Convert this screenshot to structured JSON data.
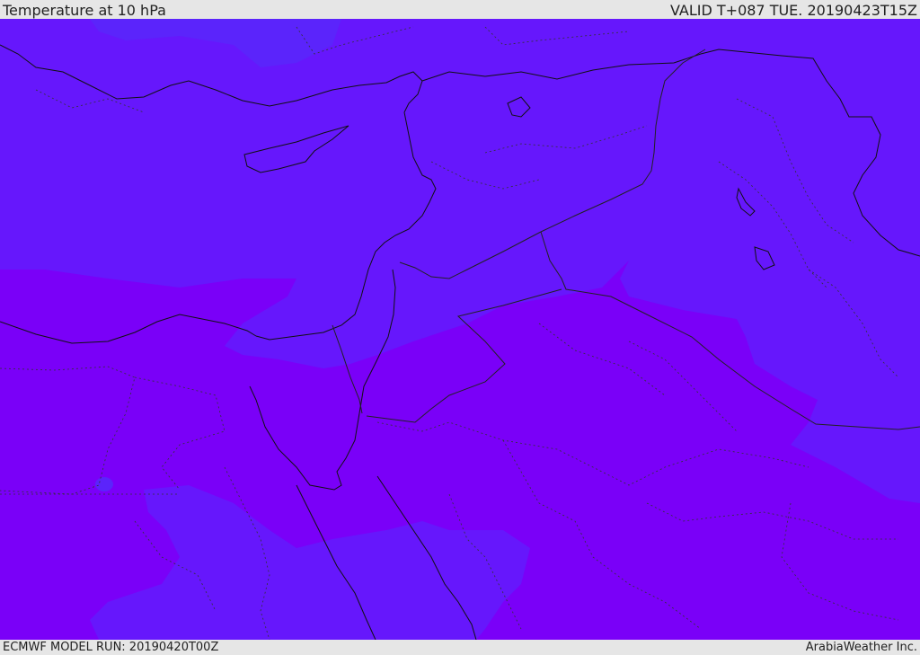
{
  "header": {
    "title": "Temperature at 10 hPa",
    "valid": "VALID T+087 TUE. 20190423T15Z"
  },
  "footer": {
    "model_run": "ECMWF MODEL RUN: 20190420T00Z",
    "brand": "ArabiaWeather Inc."
  },
  "colors": {
    "field_warm": "#7a00f8",
    "field_mid": "#6617fc",
    "field_cool": "#5b24fb",
    "coastline": "#111111",
    "border": "#222222",
    "bar_bg": "#e6e6e6"
  }
}
